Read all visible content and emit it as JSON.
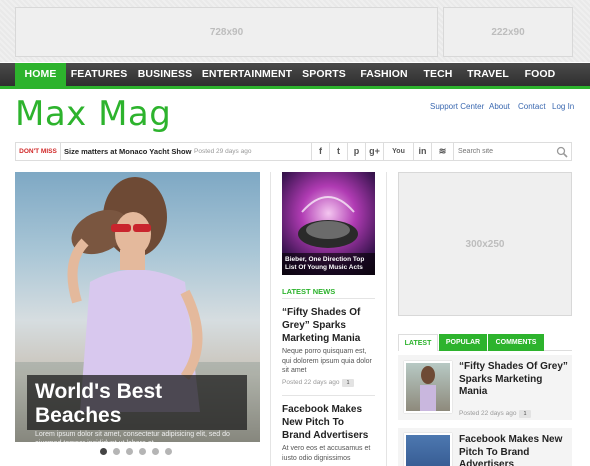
{
  "ads": {
    "leaderboard": "728x90",
    "small": "222x90",
    "rectangle": "300x250"
  },
  "nav": {
    "items": [
      "HOME",
      "FEATURES",
      "BUSINESS",
      "ENTERTAINMENT",
      "SPORTS",
      "FASHION",
      "TECH",
      "TRAVEL",
      "FOOD"
    ],
    "active_index": 0
  },
  "header": {
    "logo": "Max Mag",
    "links": [
      "Support Center",
      "About",
      "Contact",
      "Log In"
    ]
  },
  "ticker": {
    "label": "DON'T MISS",
    "title": "Size matters at Monaco Yacht Show",
    "date": "Posted 29 days ago"
  },
  "social": {
    "icons": [
      "facebook-icon",
      "twitter-icon",
      "pinterest-icon",
      "google-plus-icon",
      "youtube-icon",
      "linkedin-icon",
      "rss-icon"
    ],
    "glyphs": [
      "f",
      "t",
      "p",
      "g+",
      "You",
      "in",
      "≋"
    ]
  },
  "search": {
    "placeholder": "Search site"
  },
  "hero": {
    "title": "World's Best Beaches",
    "text": "Lorem ipsum dolor sit amet, consectetur adipisicing elit, sed do eiusmod tempor incididunt ut labore et ...",
    "dots": 6,
    "active_dot": 0
  },
  "middle": {
    "featured_caption": "Bieber, One Direction Top List Of Young Music Acts",
    "section_label": "LATEST NEWS",
    "articles": [
      {
        "title": "“Fifty Shades Of Grey” Sparks Marketing Mania",
        "excerpt": "Neque porro quisquam est, qui dolorem ipsum quia dolor sit amet",
        "date": "Posted 22 days ago",
        "comments": "1"
      },
      {
        "title": "Facebook Makes New Pitch To Brand Advertisers",
        "excerpt": "At vero eos et accusamus et iusto odio dignissimos",
        "date": "",
        "comments": ""
      }
    ]
  },
  "sidebar": {
    "tabs": [
      "LATEST",
      "POPULAR",
      "COMMENTS"
    ],
    "items": [
      {
        "title": "“Fifty Shades Of Grey” Sparks Marketing Mania",
        "date": "Posted 22 days ago",
        "comments": "1"
      },
      {
        "title": "Facebook Makes New Pitch To Brand Advertisers",
        "date": "",
        "comments": ""
      }
    ]
  },
  "colors": {
    "accent": "#2db32d",
    "nav_bg": "#3a3a3a",
    "link": "#3a68b0",
    "alert": "#d12828"
  }
}
